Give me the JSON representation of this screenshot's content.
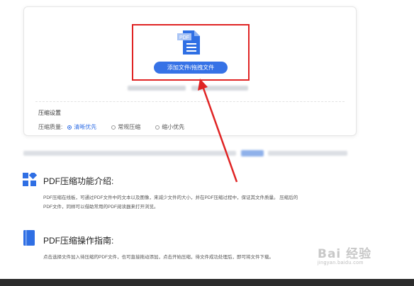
{
  "upload": {
    "icon_text": "PDF",
    "button_label": "添加文件/拖拽文件"
  },
  "settings": {
    "title": "压缩设置",
    "quality_label": "压缩质量:",
    "options": [
      {
        "label": "清晰优先",
        "selected": true
      },
      {
        "label": "常规压缩",
        "selected": false
      },
      {
        "label": "缩小优先",
        "selected": false
      }
    ]
  },
  "intro": {
    "title": "PDF压缩功能介绍:",
    "line1": "PDF压缩在线板，可通过PDF文件中的文本以及图像，来减少文件的大小，并在PDF压缩过程中，保证其文件质量。 压缩后的",
    "line2": "PDF文件，同样可以借助常用的PDF阅读器来打开浏览。"
  },
  "guide": {
    "title": "PDF压缩操作指南:",
    "line1": "点击选择文件加入待压缩的PDF文件，也可直接拖动添加，点击开始压缩，待文件成功处理后，即可将文件下载。"
  },
  "watermark": {
    "brand": "Bai 经验",
    "url": "jingyan.baidu.com"
  },
  "colors": {
    "accent": "#3672e6",
    "highlight_red": "#e02424",
    "icon_blue": "#2f6fe4"
  }
}
